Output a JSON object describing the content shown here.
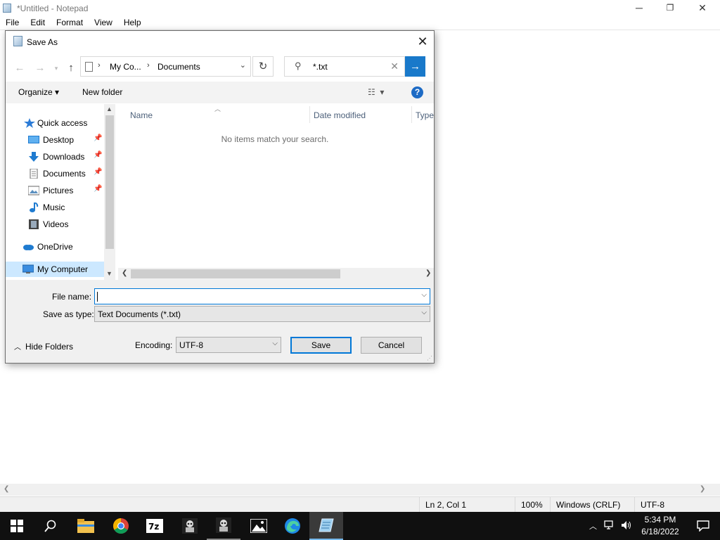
{
  "notepad": {
    "title": "*Untitled - Notepad",
    "controls": {
      "minimize": "─",
      "maximize": "❐",
      "close": "✕"
    },
    "menu": [
      "File",
      "Edit",
      "Format",
      "View",
      "Help"
    ],
    "status": {
      "position": "Ln 2, Col 1",
      "zoom": "100%",
      "line_endings": "Windows (CRLF)",
      "encoding": "UTF-8"
    }
  },
  "dialog": {
    "title": "Save As",
    "close": "✕",
    "address": {
      "crumbs": [
        "My Co...",
        "Documents"
      ],
      "separator": "›"
    },
    "search_value": "*.txt",
    "toolbar": {
      "organize": "Organize ▾",
      "new_folder": "New folder",
      "help": "?"
    },
    "nav": {
      "items": [
        {
          "label": "Quick access",
          "icon": "star-icon"
        },
        {
          "label": "Desktop",
          "icon": "desktop-icon",
          "pinned": true
        },
        {
          "label": "Downloads",
          "icon": "downloads-icon",
          "pinned": true
        },
        {
          "label": "Documents",
          "icon": "documents-icon",
          "pinned": true
        },
        {
          "label": "Pictures",
          "icon": "pictures-icon",
          "pinned": true
        },
        {
          "label": "Music",
          "icon": "music-icon"
        },
        {
          "label": "Videos",
          "icon": "videos-icon"
        },
        {
          "label": "OneDrive",
          "icon": "onedrive-icon"
        },
        {
          "label": "My Computer",
          "icon": "computer-icon",
          "selected": true
        }
      ]
    },
    "columns": [
      "Name",
      "Date modified",
      "Type"
    ],
    "empty_message": "No items match your search.",
    "form": {
      "file_name_label": "File name:",
      "file_name_value": "",
      "save_as_type_label": "Save as type:",
      "save_as_type_value": "Text Documents (*.txt)",
      "encoding_label": "Encoding:",
      "encoding_value": "UTF-8"
    },
    "hide_folders": "Hide Folders",
    "save_label": "Save",
    "cancel_label": "Cancel"
  },
  "taskbar": {
    "apps": [
      "start",
      "search",
      "file-explorer",
      "chrome",
      "7zip",
      "app-1",
      "app-2",
      "photos",
      "edge",
      "notepad"
    ],
    "time": "5:34 PM",
    "date": "6/18/2022"
  },
  "colors": {
    "accent": "#0078d7",
    "selection": "#cce8ff",
    "taskbar": "#101010"
  }
}
